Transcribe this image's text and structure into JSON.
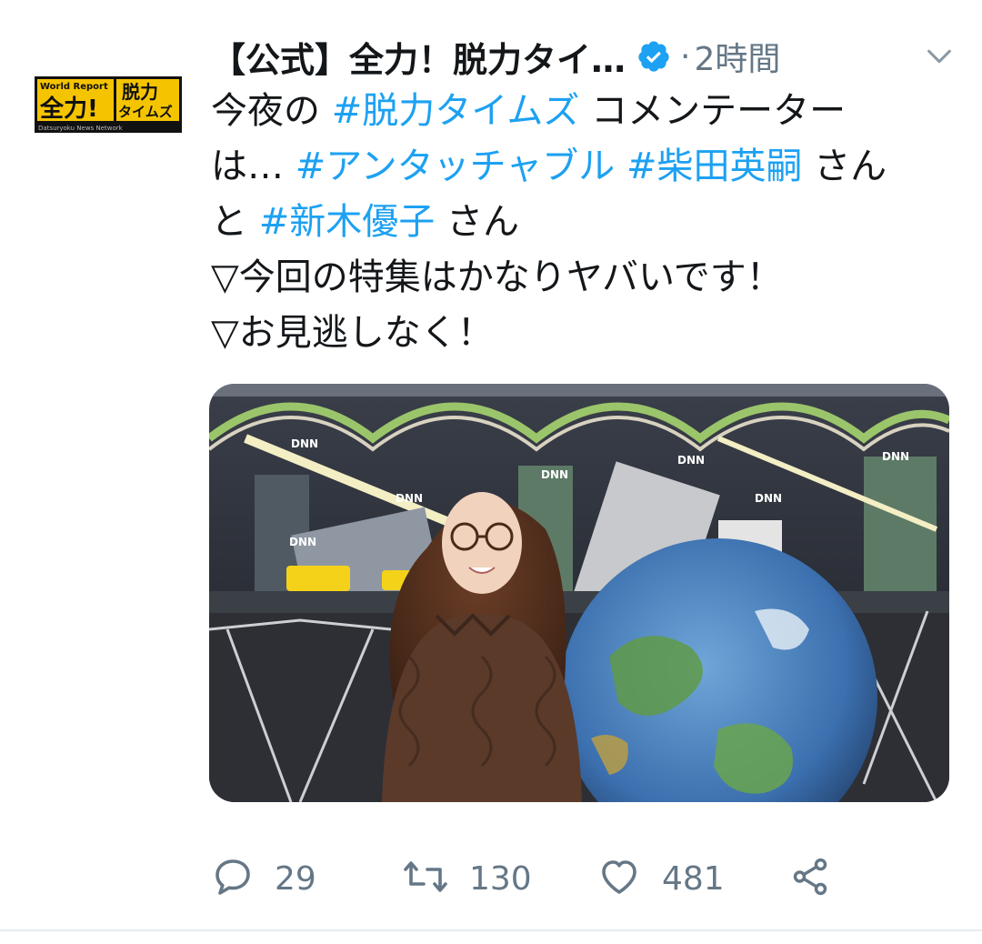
{
  "tweet": {
    "author_name": "【公式】全力！脱力タイ…",
    "verified": true,
    "separator": "·",
    "timestamp": "2時間",
    "avatar_logo": {
      "top_text": "World Report",
      "left_text": "全力!",
      "right_text_top": "脱力",
      "right_text_bottom": "タイムズ",
      "bottom_text": "Datsuryoku News Network"
    },
    "body_lines": [
      [
        {
          "t": "今夜の "
        },
        {
          "t": "#脱力タイムズ",
          "tag": true
        },
        {
          "t": " コメンテーター"
        }
      ],
      [
        {
          "t": "は… "
        },
        {
          "t": "#アンタッチャブル",
          "tag": true
        },
        {
          "t": " "
        },
        {
          "t": "#柴田英嗣",
          "tag": true
        },
        {
          "t": " さん"
        }
      ],
      [
        {
          "t": "と "
        },
        {
          "t": "#新木優子",
          "tag": true
        },
        {
          "t": " さん"
        }
      ],
      [
        {
          "t": "▽今回の特集はかなりヤバいです！"
        }
      ],
      [
        {
          "t": "▽お見逃しなく！"
        }
      ]
    ],
    "photo": {
      "set_signs": [
        "DNN",
        "DNN",
        "DNN",
        "DNN",
        "DNN",
        "DNN",
        "DNN"
      ]
    },
    "actions": {
      "replies": "29",
      "retweets": "130",
      "likes": "481"
    },
    "icons": {
      "verified": "verified-badge-icon",
      "menu": "chevron-down-icon",
      "reply": "reply-icon",
      "retweet": "retweet-icon",
      "like": "heart-icon",
      "share": "share-icon"
    },
    "colors": {
      "hashtag": "#1da1f2",
      "verified": "#1da1f2",
      "secondary_text": "#657786",
      "primary_text": "#14171a"
    }
  }
}
